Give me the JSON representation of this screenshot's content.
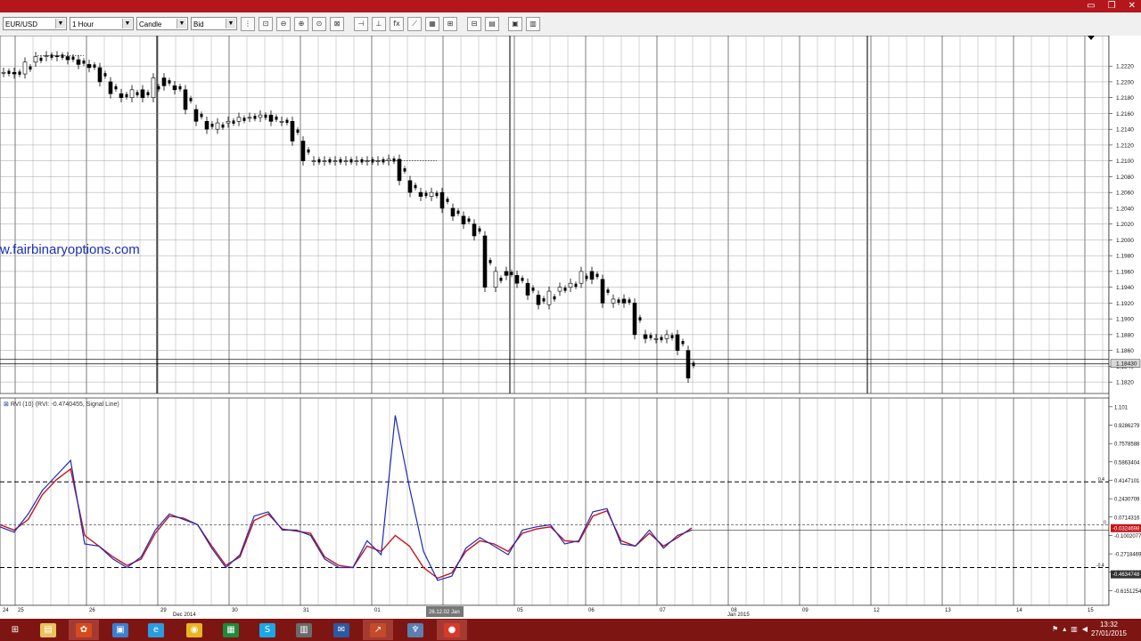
{
  "toolbar": {
    "symbol": "EUR/USD",
    "timeframe": "1 Hour",
    "chart_type": "Candle",
    "price_side": "Bid",
    "buttons": [
      "bars-icon",
      "zoom-fit-icon",
      "zoom-out-icon",
      "zoom-in-icon",
      "zoom-reset-icon",
      "zoom-area-icon",
      "draw-line-icon",
      "vertical-line-icon",
      "fx-icon",
      "trendline-icon",
      "calculator-icon",
      "indicator-add-icon",
      "indicator-remove-icon",
      "grid-icon",
      "export-icon",
      "table-icon"
    ]
  },
  "watermark": "w.fairbinaryoptions.com",
  "indicator_label": "RVI (10) (RVI: -0.4740455, Signal Line)",
  "price_axis": {
    "ticks": [
      "1.2220",
      "1.2200",
      "1.2180",
      "1.2160",
      "1.2140",
      "1.2120",
      "1.2100",
      "1.2080",
      "1.2060",
      "1.2040",
      "1.2020",
      "1.2000",
      "1.1980",
      "1.1960",
      "1.1940",
      "1.1920",
      "1.1900",
      "1.1880",
      "1.1860",
      "1.1840",
      "1.1820"
    ],
    "current_price": "1.18430"
  },
  "ind_axis": {
    "ticks": [
      "1.101",
      "0.9286279",
      "0.7578588",
      "0.5863404",
      "0.4147101",
      "0.2430709",
      "0.0714316",
      "-0.1002077",
      "-0.2718469",
      "-0.4434862",
      "-0.6151254"
    ],
    "rvi_value": "-0.0324698",
    "signal_value": "-0.4634748",
    "upper_level": "0.4",
    "zero_level": "0",
    "lower_level": "-0.4"
  },
  "time_axis": {
    "labels": [
      {
        "text": "24",
        "x": 3
      },
      {
        "text": "25",
        "x": 20
      },
      {
        "text": "26",
        "x": 100
      },
      {
        "text": "Dec 2014",
        "x": 194
      },
      {
        "text": "29",
        "x": 180
      },
      {
        "text": "30",
        "x": 260
      },
      {
        "text": "31",
        "x": 340
      },
      {
        "text": "01",
        "x": 420
      },
      {
        "text": "05",
        "x": 580
      },
      {
        "text": "06",
        "x": 660
      },
      {
        "text": "07",
        "x": 740
      },
      {
        "text": "08",
        "x": 820
      },
      {
        "text": "Jan 2015",
        "x": 816
      },
      {
        "text": "09",
        "x": 900
      },
      {
        "text": "12",
        "x": 980
      },
      {
        "text": "13",
        "x": 1060
      },
      {
        "text": "14",
        "x": 1140
      },
      {
        "text": "15",
        "x": 1220
      }
    ],
    "cursor_label": "26.12.02 Jan"
  },
  "chart_data": {
    "type": "line",
    "title": "",
    "series": [
      {
        "name": "EUR/USD",
        "values": [
          1.2212,
          1.221,
          1.2225,
          1.2232,
          1.2233,
          1.2232,
          1.2228,
          1.2222,
          1.2218,
          1.22,
          1.2185,
          1.218,
          1.219,
          1.218,
          1.2205,
          1.2195,
          1.219,
          1.2165,
          1.215,
          1.214,
          1.2148,
          1.215,
          1.2155,
          1.2155,
          1.2158,
          1.215,
          1.215,
          1.2125,
          1.21,
          1.21,
          1.21,
          1.21,
          1.21,
          1.21,
          1.21,
          1.21,
          1.2102,
          1.2075,
          1.206,
          1.2055,
          1.206,
          1.204,
          1.203,
          1.202,
          1.2005,
          1.194,
          1.196,
          1.1955,
          1.1945,
          1.193,
          1.1918,
          1.1935,
          1.194,
          1.1945,
          1.196,
          1.195,
          1.192,
          1.1925,
          1.192,
          1.188,
          1.1875,
          1.1875,
          1.188,
          1.186,
          1.1825
        ]
      },
      {
        "name": "RVI",
        "values": [
          -0.02,
          -0.07,
          0.1,
          0.32,
          0.46,
          0.6,
          -0.18,
          -0.2,
          -0.32,
          -0.4,
          -0.3,
          -0.05,
          0.1,
          0.05,
          0.0,
          -0.22,
          -0.4,
          -0.28,
          0.08,
          0.12,
          -0.05,
          -0.05,
          -0.1,
          -0.32,
          -0.4,
          -0.4,
          -0.15,
          -0.28,
          1.02,
          0.35,
          -0.25,
          -0.52,
          -0.48,
          -0.22,
          -0.12,
          -0.2,
          -0.28,
          -0.05,
          -0.02,
          0.0,
          -0.18,
          -0.15,
          0.12,
          0.15,
          -0.18,
          -0.2,
          -0.05,
          -0.22,
          -0.1,
          -0.05
        ]
      },
      {
        "name": "Signal Line",
        "values": [
          0.0,
          -0.05,
          0.05,
          0.28,
          0.42,
          0.52,
          -0.1,
          -0.2,
          -0.3,
          -0.38,
          -0.32,
          -0.08,
          0.08,
          0.06,
          0.0,
          -0.2,
          -0.38,
          -0.3,
          0.04,
          0.1,
          -0.04,
          -0.06,
          -0.08,
          -0.3,
          -0.38,
          -0.4,
          -0.2,
          -0.25,
          -0.1,
          -0.2,
          -0.4,
          -0.5,
          -0.45,
          -0.25,
          -0.15,
          -0.18,
          -0.25,
          -0.08,
          -0.04,
          -0.02,
          -0.15,
          -0.16,
          0.08,
          0.13,
          -0.15,
          -0.2,
          -0.08,
          -0.2,
          -0.12,
          -0.03
        ]
      }
    ],
    "ylim": [
      1.181,
      1.2245
    ],
    "indicator_ylim": [
      -0.72,
      1.15
    ],
    "grid": true,
    "legend": "none",
    "colors": {
      "candle": "#000000",
      "rvi": "#1f2ab8",
      "signal": "#c4161c",
      "level": "#000000"
    }
  },
  "taskbar": {
    "clock_time": "13:32",
    "clock_date": "27/01/2015",
    "apps": [
      {
        "name": "start-icon",
        "color": "#ffffff",
        "glyph": "⊞"
      },
      {
        "name": "file-explorer-icon",
        "color": "#e8c35a",
        "glyph": "▤"
      },
      {
        "name": "trading-app-icon",
        "color": "#d64a1e",
        "glyph": "✿"
      },
      {
        "name": "screen-recorder-icon",
        "color": "#3a7fd0",
        "glyph": "▣"
      },
      {
        "name": "internet-explorer-icon",
        "color": "#2a9be0",
        "glyph": "e"
      },
      {
        "name": "chrome-icon",
        "color": "#e8b623",
        "glyph": "◉"
      },
      {
        "name": "spreadsheet-icon",
        "color": "#1e8a3a",
        "glyph": "▦"
      },
      {
        "name": "skype-icon",
        "color": "#1aa7e8",
        "glyph": "S"
      },
      {
        "name": "calculator-icon",
        "color": "#6a6a6a",
        "glyph": "▥"
      },
      {
        "name": "mail-icon",
        "color": "#2c5aa0",
        "glyph": "✉"
      },
      {
        "name": "chart-app-icon",
        "color": "#c44a2a",
        "glyph": "↗"
      },
      {
        "name": "network-tool-icon",
        "color": "#5a7fb0",
        "glyph": "♆"
      },
      {
        "name": "recorder-icon",
        "color": "#d8392a",
        "glyph": "●"
      }
    ]
  }
}
